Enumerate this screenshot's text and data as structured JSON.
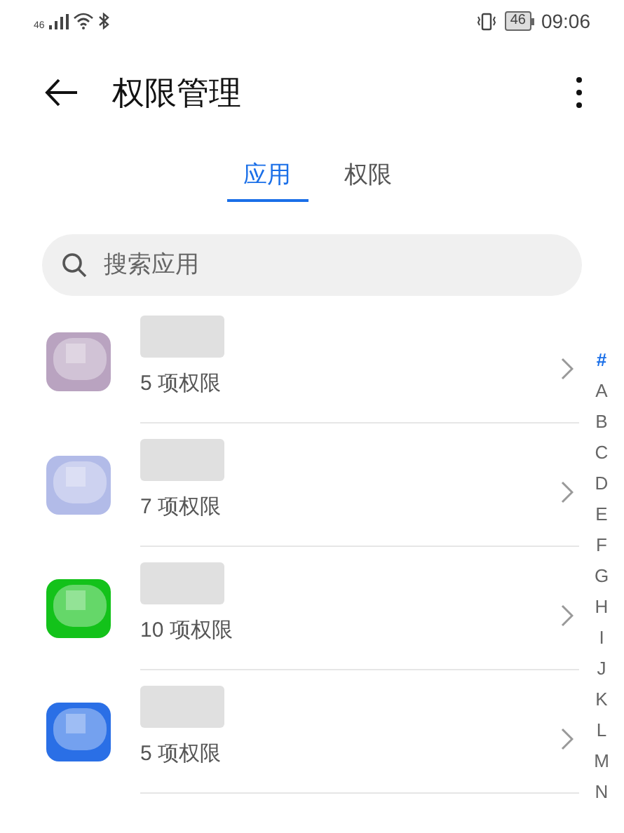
{
  "status_bar": {
    "network": "46",
    "battery": "46",
    "time": "09:06"
  },
  "header": {
    "title": "权限管理"
  },
  "tabs": [
    {
      "label": "应用",
      "selected": true
    },
    {
      "label": "权限",
      "selected": false
    }
  ],
  "search": {
    "placeholder": "搜索应用"
  },
  "apps": [
    {
      "permissions": "5 项权限",
      "color": "#b9a3c0"
    },
    {
      "permissions": "7 项权限",
      "color": "#b2bbe8"
    },
    {
      "permissions": "10 项权限",
      "color": "#13c21a"
    },
    {
      "permissions": "5 项权限",
      "color": "#2a6fe6"
    }
  ],
  "index": [
    {
      "label": "#",
      "selected": true
    },
    {
      "label": "A",
      "selected": false
    },
    {
      "label": "B",
      "selected": false
    },
    {
      "label": "C",
      "selected": false
    },
    {
      "label": "D",
      "selected": false
    },
    {
      "label": "E",
      "selected": false
    },
    {
      "label": "F",
      "selected": false
    },
    {
      "label": "G",
      "selected": false
    },
    {
      "label": "H",
      "selected": false
    },
    {
      "label": "I",
      "selected": false
    },
    {
      "label": "J",
      "selected": false
    },
    {
      "label": "K",
      "selected": false
    },
    {
      "label": "L",
      "selected": false
    },
    {
      "label": "M",
      "selected": false
    },
    {
      "label": "N",
      "selected": false
    }
  ]
}
